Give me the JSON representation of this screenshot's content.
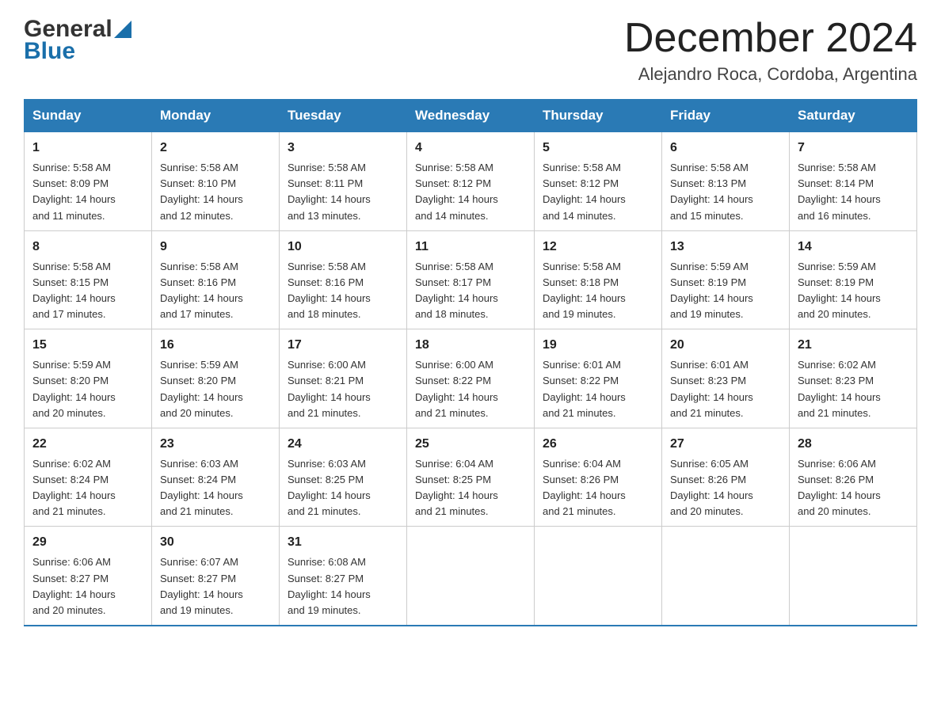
{
  "header": {
    "logo_general": "General",
    "logo_blue": "Blue",
    "month_title": "December 2024",
    "location": "Alejandro Roca, Cordoba, Argentina"
  },
  "days_of_week": [
    "Sunday",
    "Monday",
    "Tuesday",
    "Wednesday",
    "Thursday",
    "Friday",
    "Saturday"
  ],
  "weeks": [
    [
      {
        "day": "1",
        "sunrise": "5:58 AM",
        "sunset": "8:09 PM",
        "daylight": "14 hours and 11 minutes."
      },
      {
        "day": "2",
        "sunrise": "5:58 AM",
        "sunset": "8:10 PM",
        "daylight": "14 hours and 12 minutes."
      },
      {
        "day": "3",
        "sunrise": "5:58 AM",
        "sunset": "8:11 PM",
        "daylight": "14 hours and 13 minutes."
      },
      {
        "day": "4",
        "sunrise": "5:58 AM",
        "sunset": "8:12 PM",
        "daylight": "14 hours and 14 minutes."
      },
      {
        "day": "5",
        "sunrise": "5:58 AM",
        "sunset": "8:12 PM",
        "daylight": "14 hours and 14 minutes."
      },
      {
        "day": "6",
        "sunrise": "5:58 AM",
        "sunset": "8:13 PM",
        "daylight": "14 hours and 15 minutes."
      },
      {
        "day": "7",
        "sunrise": "5:58 AM",
        "sunset": "8:14 PM",
        "daylight": "14 hours and 16 minutes."
      }
    ],
    [
      {
        "day": "8",
        "sunrise": "5:58 AM",
        "sunset": "8:15 PM",
        "daylight": "14 hours and 17 minutes."
      },
      {
        "day": "9",
        "sunrise": "5:58 AM",
        "sunset": "8:16 PM",
        "daylight": "14 hours and 17 minutes."
      },
      {
        "day": "10",
        "sunrise": "5:58 AM",
        "sunset": "8:16 PM",
        "daylight": "14 hours and 18 minutes."
      },
      {
        "day": "11",
        "sunrise": "5:58 AM",
        "sunset": "8:17 PM",
        "daylight": "14 hours and 18 minutes."
      },
      {
        "day": "12",
        "sunrise": "5:58 AM",
        "sunset": "8:18 PM",
        "daylight": "14 hours and 19 minutes."
      },
      {
        "day": "13",
        "sunrise": "5:59 AM",
        "sunset": "8:19 PM",
        "daylight": "14 hours and 19 minutes."
      },
      {
        "day": "14",
        "sunrise": "5:59 AM",
        "sunset": "8:19 PM",
        "daylight": "14 hours and 20 minutes."
      }
    ],
    [
      {
        "day": "15",
        "sunrise": "5:59 AM",
        "sunset": "8:20 PM",
        "daylight": "14 hours and 20 minutes."
      },
      {
        "day": "16",
        "sunrise": "5:59 AM",
        "sunset": "8:20 PM",
        "daylight": "14 hours and 20 minutes."
      },
      {
        "day": "17",
        "sunrise": "6:00 AM",
        "sunset": "8:21 PM",
        "daylight": "14 hours and 21 minutes."
      },
      {
        "day": "18",
        "sunrise": "6:00 AM",
        "sunset": "8:22 PM",
        "daylight": "14 hours and 21 minutes."
      },
      {
        "day": "19",
        "sunrise": "6:01 AM",
        "sunset": "8:22 PM",
        "daylight": "14 hours and 21 minutes."
      },
      {
        "day": "20",
        "sunrise": "6:01 AM",
        "sunset": "8:23 PM",
        "daylight": "14 hours and 21 minutes."
      },
      {
        "day": "21",
        "sunrise": "6:02 AM",
        "sunset": "8:23 PM",
        "daylight": "14 hours and 21 minutes."
      }
    ],
    [
      {
        "day": "22",
        "sunrise": "6:02 AM",
        "sunset": "8:24 PM",
        "daylight": "14 hours and 21 minutes."
      },
      {
        "day": "23",
        "sunrise": "6:03 AM",
        "sunset": "8:24 PM",
        "daylight": "14 hours and 21 minutes."
      },
      {
        "day": "24",
        "sunrise": "6:03 AM",
        "sunset": "8:25 PM",
        "daylight": "14 hours and 21 minutes."
      },
      {
        "day": "25",
        "sunrise": "6:04 AM",
        "sunset": "8:25 PM",
        "daylight": "14 hours and 21 minutes."
      },
      {
        "day": "26",
        "sunrise": "6:04 AM",
        "sunset": "8:26 PM",
        "daylight": "14 hours and 21 minutes."
      },
      {
        "day": "27",
        "sunrise": "6:05 AM",
        "sunset": "8:26 PM",
        "daylight": "14 hours and 20 minutes."
      },
      {
        "day": "28",
        "sunrise": "6:06 AM",
        "sunset": "8:26 PM",
        "daylight": "14 hours and 20 minutes."
      }
    ],
    [
      {
        "day": "29",
        "sunrise": "6:06 AM",
        "sunset": "8:27 PM",
        "daylight": "14 hours and 20 minutes."
      },
      {
        "day": "30",
        "sunrise": "6:07 AM",
        "sunset": "8:27 PM",
        "daylight": "14 hours and 19 minutes."
      },
      {
        "day": "31",
        "sunrise": "6:08 AM",
        "sunset": "8:27 PM",
        "daylight": "14 hours and 19 minutes."
      },
      null,
      null,
      null,
      null
    ]
  ],
  "labels": {
    "sunrise": "Sunrise:",
    "sunset": "Sunset:",
    "daylight": "Daylight:"
  }
}
